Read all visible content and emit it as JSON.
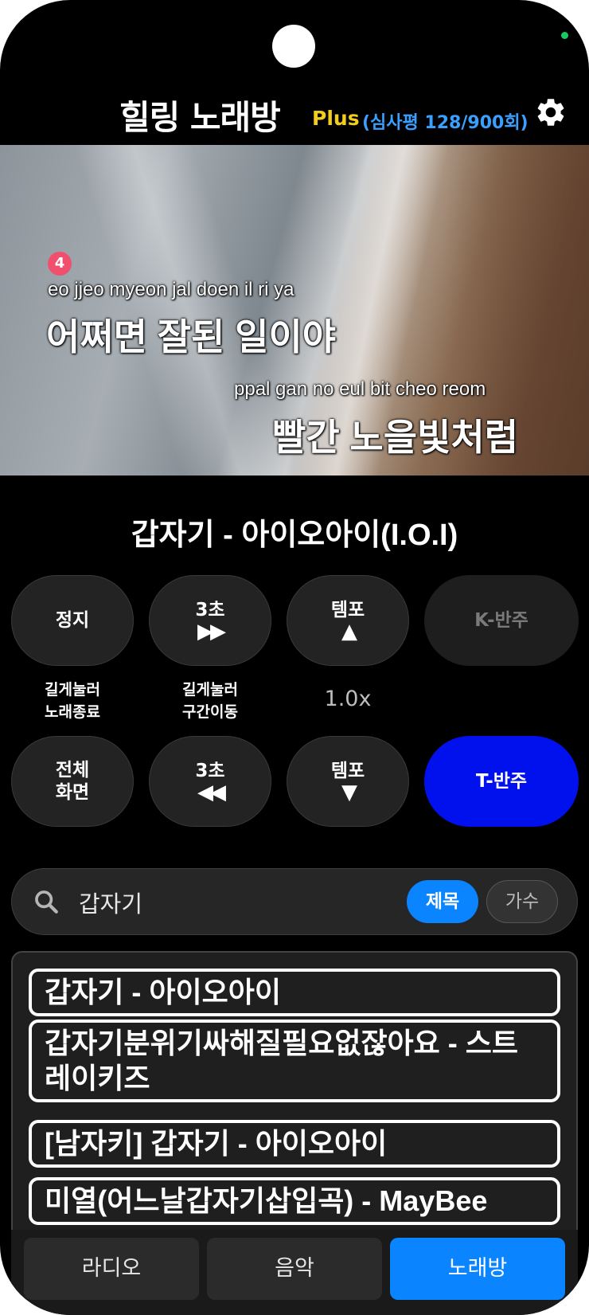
{
  "header": {
    "app_title": "힐링 노래방",
    "plus_label": "Plus",
    "review_count": "(심사평 128/900회)",
    "settings_icon": "gear-icon"
  },
  "video": {
    "line_number": "4",
    "line1_romanized": "eo jjeo myeon jal doen il ri ya",
    "line1_korean": "어쩌면 잘된 일이야",
    "line2_romanized": "ppal gan no eul bit cheo reom",
    "line2_korean": "빨간 노을빛처럼"
  },
  "now_playing": {
    "title": "갑자기 - 아이오아이(I.O.I)"
  },
  "controls": {
    "stop": "정지",
    "forward_label": "3초",
    "forward_symbol": "▶▶",
    "tempo_up_label": "템포",
    "tempo_up_symbol": "▲",
    "k_accompaniment": "K-반주",
    "stop_hint_line1": "길게눌러",
    "stop_hint_line2": "노래종료",
    "forward_hint_line1": "길게눌러",
    "forward_hint_line2": "구간이동",
    "tempo_value": "1.0x",
    "fullscreen_line1": "전체",
    "fullscreen_line2": "화면",
    "rewind_label": "3초",
    "rewind_symbol": "◀◀",
    "tempo_down_label": "템포",
    "tempo_down_symbol": "▼",
    "t_accompaniment": "T-반주"
  },
  "search": {
    "value": "갑자기",
    "filter_title": "제목",
    "filter_singer": "가수"
  },
  "results": [
    "갑자기 - 아이오아이",
    "갑자기분위기싸해질필요없잖아요 - 스트레이키즈",
    "[남자키] 갑자기 - 아이오아이",
    "미열(어느날갑자기삽입곡) - MayBee"
  ],
  "bottom_nav": {
    "radio": "라디오",
    "music": "음악",
    "karaoke": "노래방"
  },
  "colors": {
    "accent_blue": "#0a84ff",
    "t_accompaniment_blue": "#0011ee",
    "plus_yellow": "#f2cd1b",
    "review_blue": "#3aa0ff"
  }
}
